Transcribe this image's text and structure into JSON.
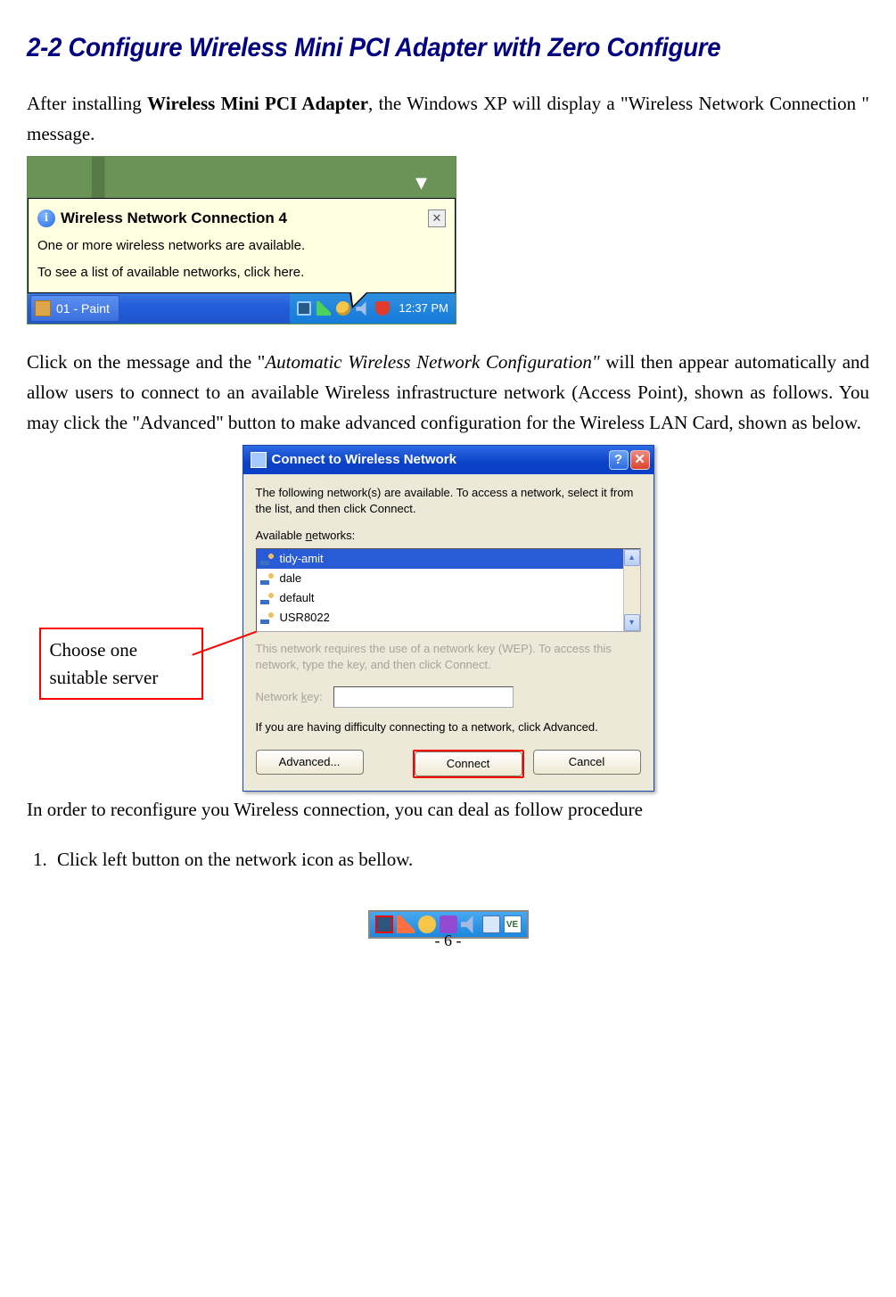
{
  "section_title": "2-2 Configure Wireless Mini PCI Adapter with Zero Configure",
  "para1": {
    "pre": "After installing ",
    "bold": "Wireless Mini PCI Adapter",
    "post": ", the Windows XP will display a \"Wireless Network Connection \" message."
  },
  "para2": {
    "pre": "Click on the message and the \"",
    "italic": "Automatic Wireless Network Configuration\"",
    "post": " will then appear automatically and allow users to connect to an available Wireless infrastructure network (Access Point), shown as follows. You may click the \"Advanced\" button to make advanced configuration for the Wireless LAN Card, shown as below."
  },
  "para3": "In order to reconfigure you Wireless connection, you can deal as follow procedure",
  "step1": "Click left button on the network icon as bellow.",
  "page_num": "- 6 -",
  "shot1": {
    "balloon_title": "Wireless Network Connection 4",
    "line1": "One or more wireless networks are available.",
    "line2": "To see a list of available networks, click here.",
    "taskbar_app": "01 - Paint",
    "clock": "12:37 PM"
  },
  "callout": {
    "line1": "Choose one",
    "line2": "suitable server"
  },
  "dialog": {
    "title": "Connect to Wireless Network",
    "intro": "The following network(s) are available. To access a network, select it from the list, and then click Connect.",
    "list_label_pre": "Available ",
    "list_label_u": "n",
    "list_label_post": "etworks:",
    "networks": [
      "tidy-amit",
      "dale",
      "default",
      "USR8022"
    ],
    "wep_hint": "This network requires the use of a network key (WEP). To access this network, type the key, and then click Connect.",
    "key_label_pre": "Network ",
    "key_label_u": "k",
    "key_label_post": "ey:",
    "adv_hint": "If you are having difficulty connecting to a network, click Advanced.",
    "btn_advanced": "Advanced...",
    "btn_connect": "Connect",
    "btn_cancel": "Cancel"
  },
  "ministrip": {
    "vnc": "VE"
  }
}
